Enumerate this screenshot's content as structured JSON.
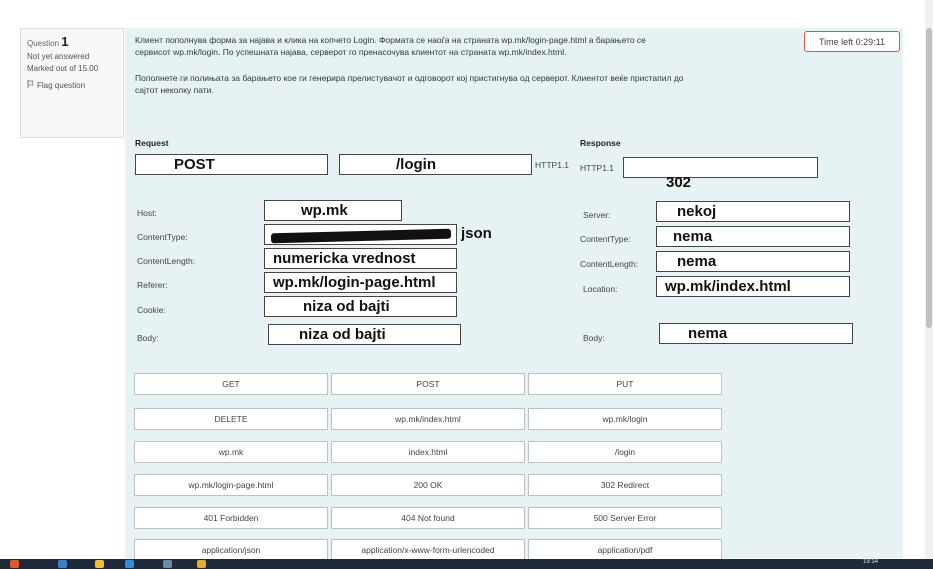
{
  "question_info": {
    "question_prefix": "Question",
    "number": "1",
    "status": "Not yet answered",
    "marked_out_of": "Marked out of 15.00",
    "flag_label": "Flag question"
  },
  "timer": "Time left 0:29:11",
  "question_text": {
    "para1_line1": "Клиент пополнува форма за најава и клика на копчето Login. Формата се наоѓа на страната wp.mk/login-page.html а барањето се",
    "para1_line2": "сервисот wp.mk/login. По успешната најава, серверот го пренасочува клиентот на страната wp.mk/index.html.",
    "para2_line1": "Пополнете ги полињата за барањето кое ги генерира прелистувачот и одговорот кој пристигнува од серверот. Клиентот веќе пристапил до",
    "para2_line2": "сајтот неколку пати."
  },
  "request": {
    "title": "Request",
    "method": "POST",
    "path": "/login",
    "version": "HTTP1.1",
    "fields": {
      "host_label": "Host:",
      "host_value": "wp.mk",
      "content_type_label": "ContentType:",
      "content_type_value": "json",
      "content_length_label": "ContentLength:",
      "content_length_value": "numericka vrednost",
      "referer_label": "Referer:",
      "referer_value": "wp.mk/login-page.html",
      "cookie_label": "Cookie:",
      "cookie_value": "niza od bajti",
      "body_label": "Body:",
      "body_value": "niza od bajti"
    }
  },
  "response": {
    "title": "Response",
    "version": "HTTP1.1",
    "status_value": "302",
    "fields": {
      "server_label": "Server:",
      "server_value": "nekoj",
      "content_type_label": "ContentType:",
      "content_type_value": "nema",
      "content_length_label": "ContentLength:",
      "content_length_value": "nema",
      "location_label": "Location:",
      "location_value": "wp.mk/index.html",
      "body_label": "Body:",
      "body_value": "nema"
    }
  },
  "options": [
    "GET",
    "POST",
    "PUT",
    "DELETE",
    "wp.mk/index.html",
    "wp.mk/login",
    "wp.mk",
    "index.html",
    "/login",
    "wp.mk/login-page.html",
    "200 OK",
    "302 Redirect",
    "401 Forbidden",
    "404 Not found",
    "500 Server Error",
    "application/json",
    "application/x-www-form-urlencoded",
    "application/pdf"
  ],
  "taskbar": {
    "time": "19:14"
  },
  "colors": {
    "panel_bg": "#e7f2f5",
    "timer_border": "#d9534f",
    "taskbar_bg": "#1f2b3a"
  }
}
